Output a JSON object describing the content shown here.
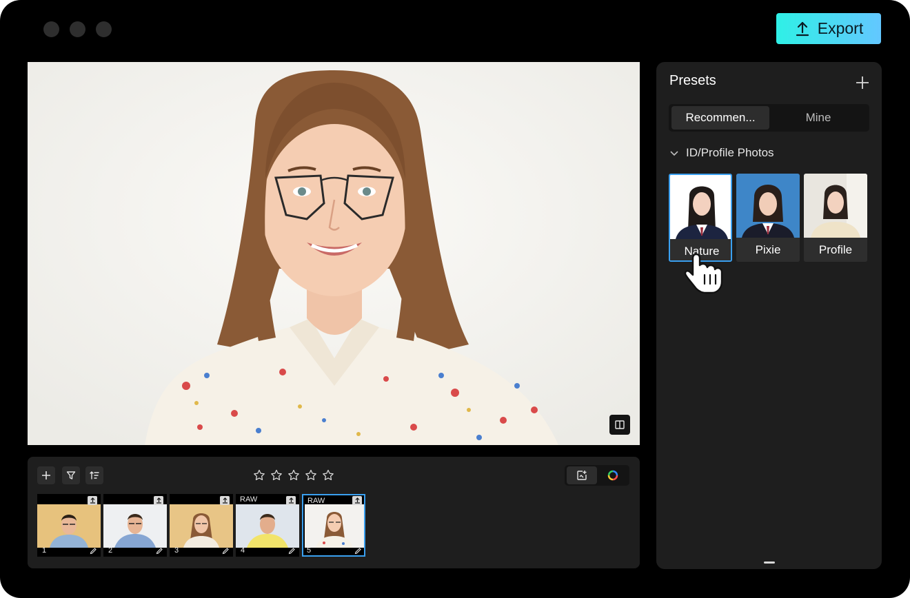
{
  "toolbar": {
    "export_label": "Export",
    "export_icon": "upload-icon"
  },
  "presets": {
    "title": "Presets",
    "tabs": [
      "Recommen...",
      "Mine"
    ],
    "active_tab": 0,
    "section_label": "ID/Profile Photos",
    "items": [
      {
        "label": "Nature",
        "selected": true
      },
      {
        "label": "Pixie",
        "selected": false
      },
      {
        "label": "Profile",
        "selected": false
      }
    ]
  },
  "filmstrip": {
    "rating_stars": 5,
    "thumbnails": [
      {
        "number": "1",
        "badge": "",
        "selected": false
      },
      {
        "number": "2",
        "badge": "",
        "selected": false
      },
      {
        "number": "3",
        "badge": "",
        "selected": false
      },
      {
        "number": "4",
        "badge": "RAW",
        "selected": false
      },
      {
        "number": "5",
        "badge": "RAW",
        "selected": true
      }
    ]
  },
  "colors": {
    "accent": "#3aa0f0",
    "export_gradient_start": "#2ff0e6",
    "export_gradient_end": "#63c7ff"
  }
}
